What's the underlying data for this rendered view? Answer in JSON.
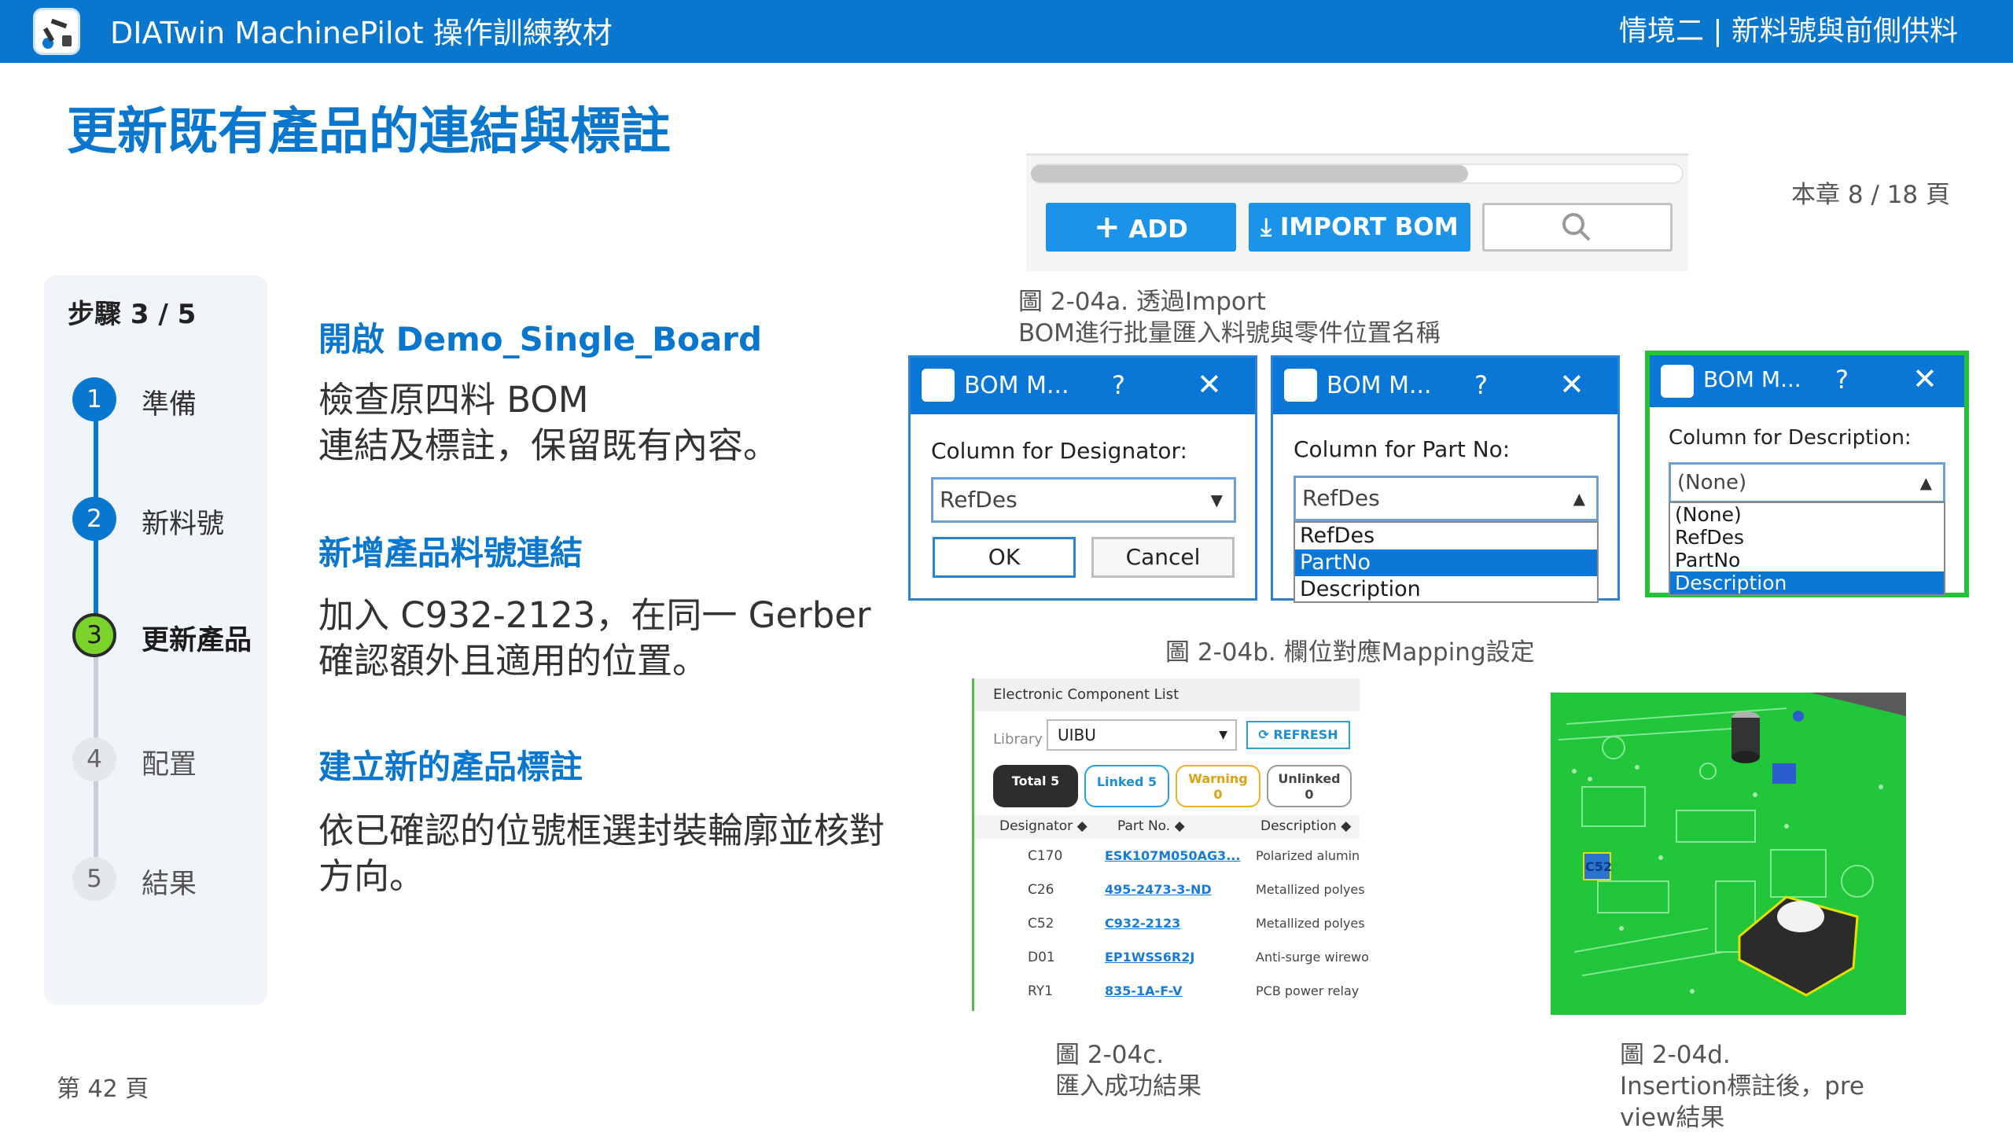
{
  "header": {
    "app_title": "DIATwin MachinePilot 操作訓練教材",
    "chapter": "情境二 | 新料號與前側供料",
    "logo_icon": "robot-arm-icon"
  },
  "page": {
    "title": "更新既有產品的連結與標註",
    "chapter_progress": "本章 8 / 18 頁",
    "page_number": "第 42 頁"
  },
  "steps": {
    "header": "步驟 3 / 5",
    "items": [
      {
        "num": "1",
        "label": "準備",
        "state": "done"
      },
      {
        "num": "2",
        "label": "新料號",
        "state": "done"
      },
      {
        "num": "3",
        "label": "更新產品",
        "state": "current"
      },
      {
        "num": "4",
        "label": "配置",
        "state": "pending"
      },
      {
        "num": "5",
        "label": "結果",
        "state": "pending"
      }
    ]
  },
  "sections": [
    {
      "heading": "開啟 Demo_Single_Board",
      "body": "檢查原四料 BOM\n連結及標註，保留既有內容。"
    },
    {
      "heading": "新增產品料號連結",
      "body": "加入 C932-2123，在同一 Gerber\n確認額外且適用的位置。"
    },
    {
      "heading": "建立新的產品標註",
      "body": "依已確認的位號框選封裝輪廓並核對\n方向。"
    }
  ],
  "fig_a": {
    "add_label": "ADD",
    "import_label": "IMPORT BOM",
    "caption": "圖 2-04a. 透過Import\nBOM進行批量匯入料號與零件位置名稱"
  },
  "fig_b": {
    "caption": "圖 2-04b. 欄位對應Mapping設定",
    "dialogs": [
      {
        "title": "BOM M...",
        "help": "?",
        "close": "✕",
        "label": "Column for Designator:",
        "value": "RefDes",
        "ok": "OK",
        "cancel": "Cancel"
      },
      {
        "title": "BOM M...",
        "help": "?",
        "close": "✕",
        "label": "Column for Part No:",
        "value": "RefDes",
        "options": [
          "RefDes",
          "PartNo",
          "Description"
        ],
        "selected": "PartNo"
      },
      {
        "title": "BOM M...",
        "help": "?",
        "close": "✕",
        "label": "Column for Description:",
        "value": "(None)",
        "options": [
          "(None)",
          "RefDes",
          "PartNo",
          "Description"
        ],
        "selected": "Description"
      }
    ]
  },
  "fig_c": {
    "header": "Electronic Component List",
    "library_label": "Library",
    "library_value": "UIBU",
    "refresh": "REFRESH",
    "pills": {
      "total": "Total 5",
      "linked": "Linked 5",
      "warning_label": "Warning",
      "warning_count": "0",
      "unlinked_label": "Unlinked",
      "unlinked_count": "0"
    },
    "columns": [
      "Designator ◆",
      "Part No. ◆",
      "Description ◆"
    ],
    "rows": [
      {
        "designator": "C170",
        "part_no": "ESK107M050AG3...",
        "description": "Polarized alumin"
      },
      {
        "designator": "C26",
        "part_no": "495-2473-3-ND",
        "description": "Metallized polyes"
      },
      {
        "designator": "C52",
        "part_no": "C932-2123",
        "description": "Metallized polyes"
      },
      {
        "designator": "D01",
        "part_no": "EP1WSS6R2J",
        "description": "Anti-surge wirewo"
      },
      {
        "designator": "RY1",
        "part_no": "835-1A-F-V",
        "description": "PCB power relay"
      }
    ],
    "caption": "圖 2-04c.\n匯入成功結果"
  },
  "fig_d": {
    "tag": "C52",
    "caption": "圖 2-04d.\nInsertion標註後，pre\nview結果"
  },
  "colors": {
    "brand": "#0a77cf",
    "current_step": "#7bd32b",
    "pcb": "#21c63a",
    "link": "#1a7bd6"
  }
}
